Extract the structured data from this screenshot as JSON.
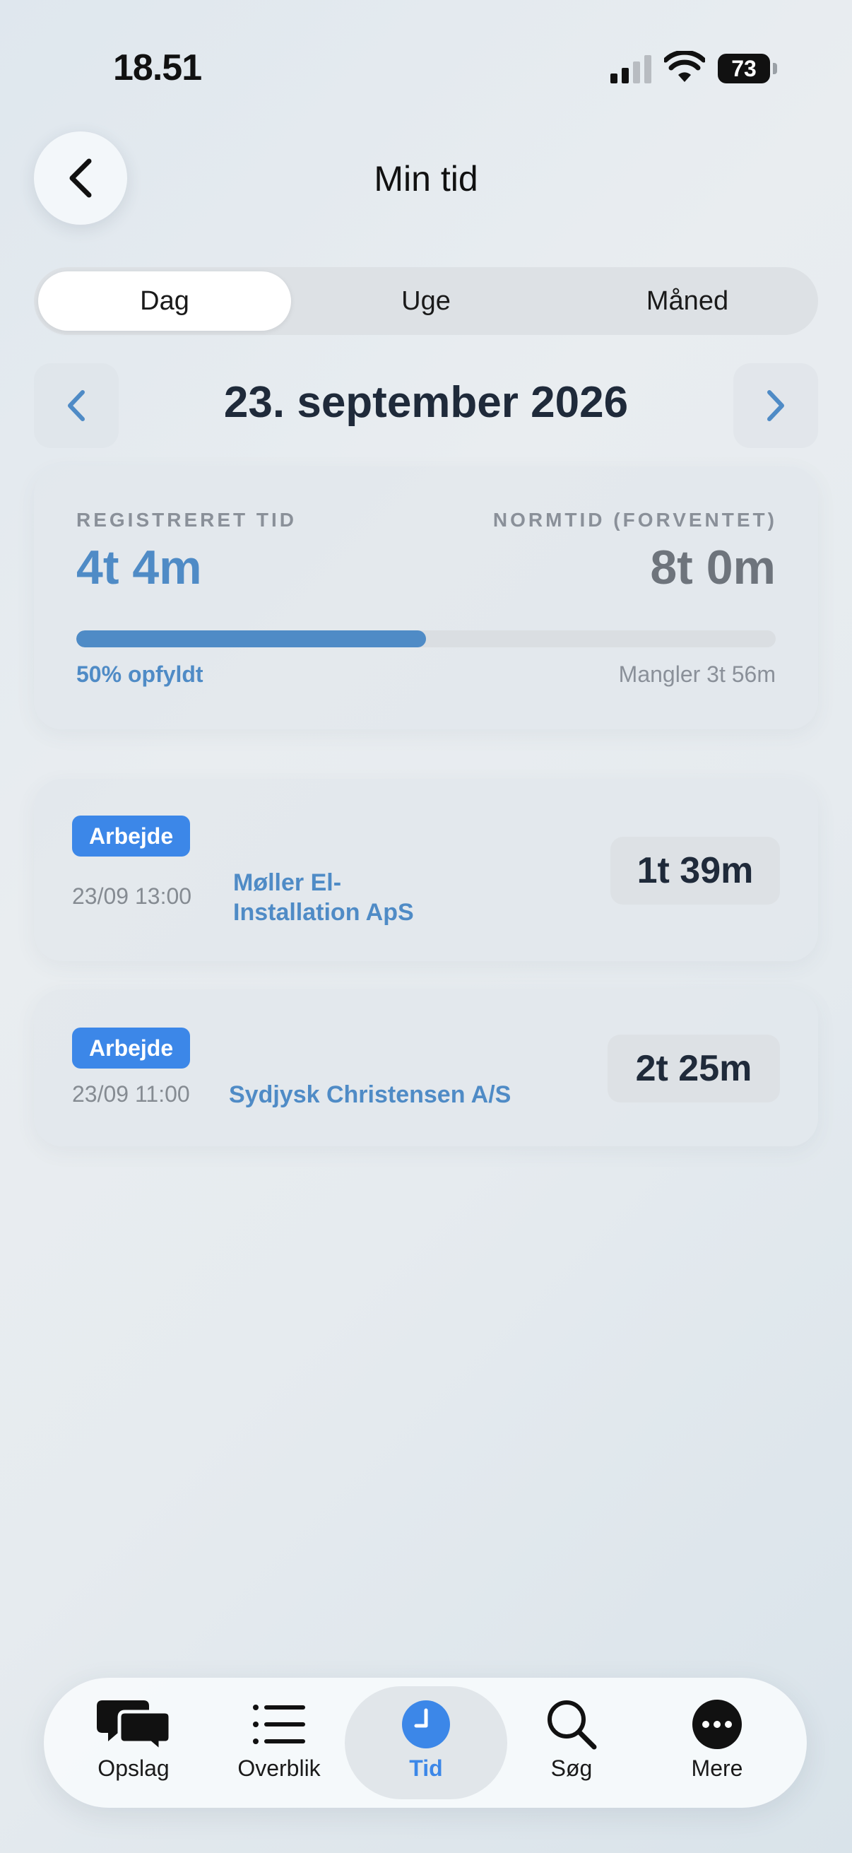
{
  "status_bar": {
    "time": "18.51",
    "battery": "73"
  },
  "header": {
    "title": "Min tid"
  },
  "segments": [
    {
      "label": "Dag",
      "active": true
    },
    {
      "label": "Uge",
      "active": false
    },
    {
      "label": "Måned",
      "active": false
    }
  ],
  "date_nav": {
    "date": "23. september 2026"
  },
  "summary": {
    "registered_label": "REGISTRERET TID",
    "registered_value": "4t 4m",
    "norm_label": "NORMTID (FORVENTET)",
    "norm_value": "8t 0m",
    "progress_fraction": 0.5,
    "progress_text": "50% opfyldt",
    "missing_text": "Mangler 3t 56m"
  },
  "entries": [
    {
      "type": "Arbejde",
      "datetime": "23/09 13:00",
      "client_line1": "Møller El-",
      "client_line2": "Installation ApS",
      "duration": "1t 39m"
    },
    {
      "type": "Arbejde",
      "datetime": "23/09 11:00",
      "client_line1": "Sydjysk Christensen A/S",
      "client_line2": "",
      "duration": "2t 25m"
    }
  ],
  "tabbar": [
    {
      "label": "Opslag",
      "icon": "chat-bubbles-icon"
    },
    {
      "label": "Overblik",
      "icon": "list-icon"
    },
    {
      "label": "Tid",
      "icon": "clock-icon",
      "active": true
    },
    {
      "label": "Søg",
      "icon": "search-icon"
    },
    {
      "label": "Mere",
      "icon": "more-icon"
    }
  ],
  "colors": {
    "accent": "#3c87e8",
    "accent_text": "#4f8bc6"
  }
}
